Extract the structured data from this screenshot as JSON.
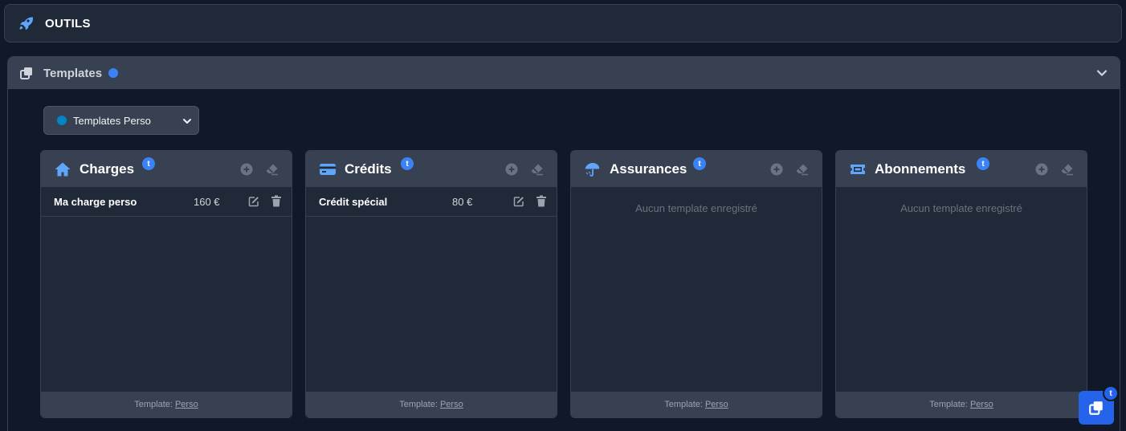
{
  "topbar": {
    "title": "OUTILS",
    "icon": "rocket-icon"
  },
  "panel": {
    "title": "Templates",
    "status_color": "#3b82f6"
  },
  "select": {
    "value": "Templates Perso",
    "dot_color": "#0284c7"
  },
  "badge_letter": "t",
  "cards": [
    {
      "title": "Charges",
      "icon": "home-icon",
      "items": [
        {
          "name": "Ma charge perso",
          "amount": "160 €"
        }
      ],
      "empty_text": "",
      "footer_label": "Template:",
      "footer_link": "Perso"
    },
    {
      "title": "Crédits",
      "icon": "credit-card-icon",
      "items": [
        {
          "name": "Crédit spécial",
          "amount": "80 €"
        }
      ],
      "empty_text": "",
      "footer_label": "Template:",
      "footer_link": "Perso"
    },
    {
      "title": "Assurances",
      "icon": "umbrella-icon",
      "items": [],
      "empty_text": "Aucun template enregistré",
      "footer_label": "Template:",
      "footer_link": "Perso"
    },
    {
      "title": "Abonnements",
      "icon": "ticket-icon",
      "items": [],
      "empty_text": "Aucun template enregistré",
      "footer_label": "Template:",
      "footer_link": "Perso"
    }
  ],
  "colors": {
    "accent": "#3b82f6",
    "icon": "#60a5fa",
    "background": "#111827",
    "card": "#1f2937",
    "header": "#374151"
  }
}
